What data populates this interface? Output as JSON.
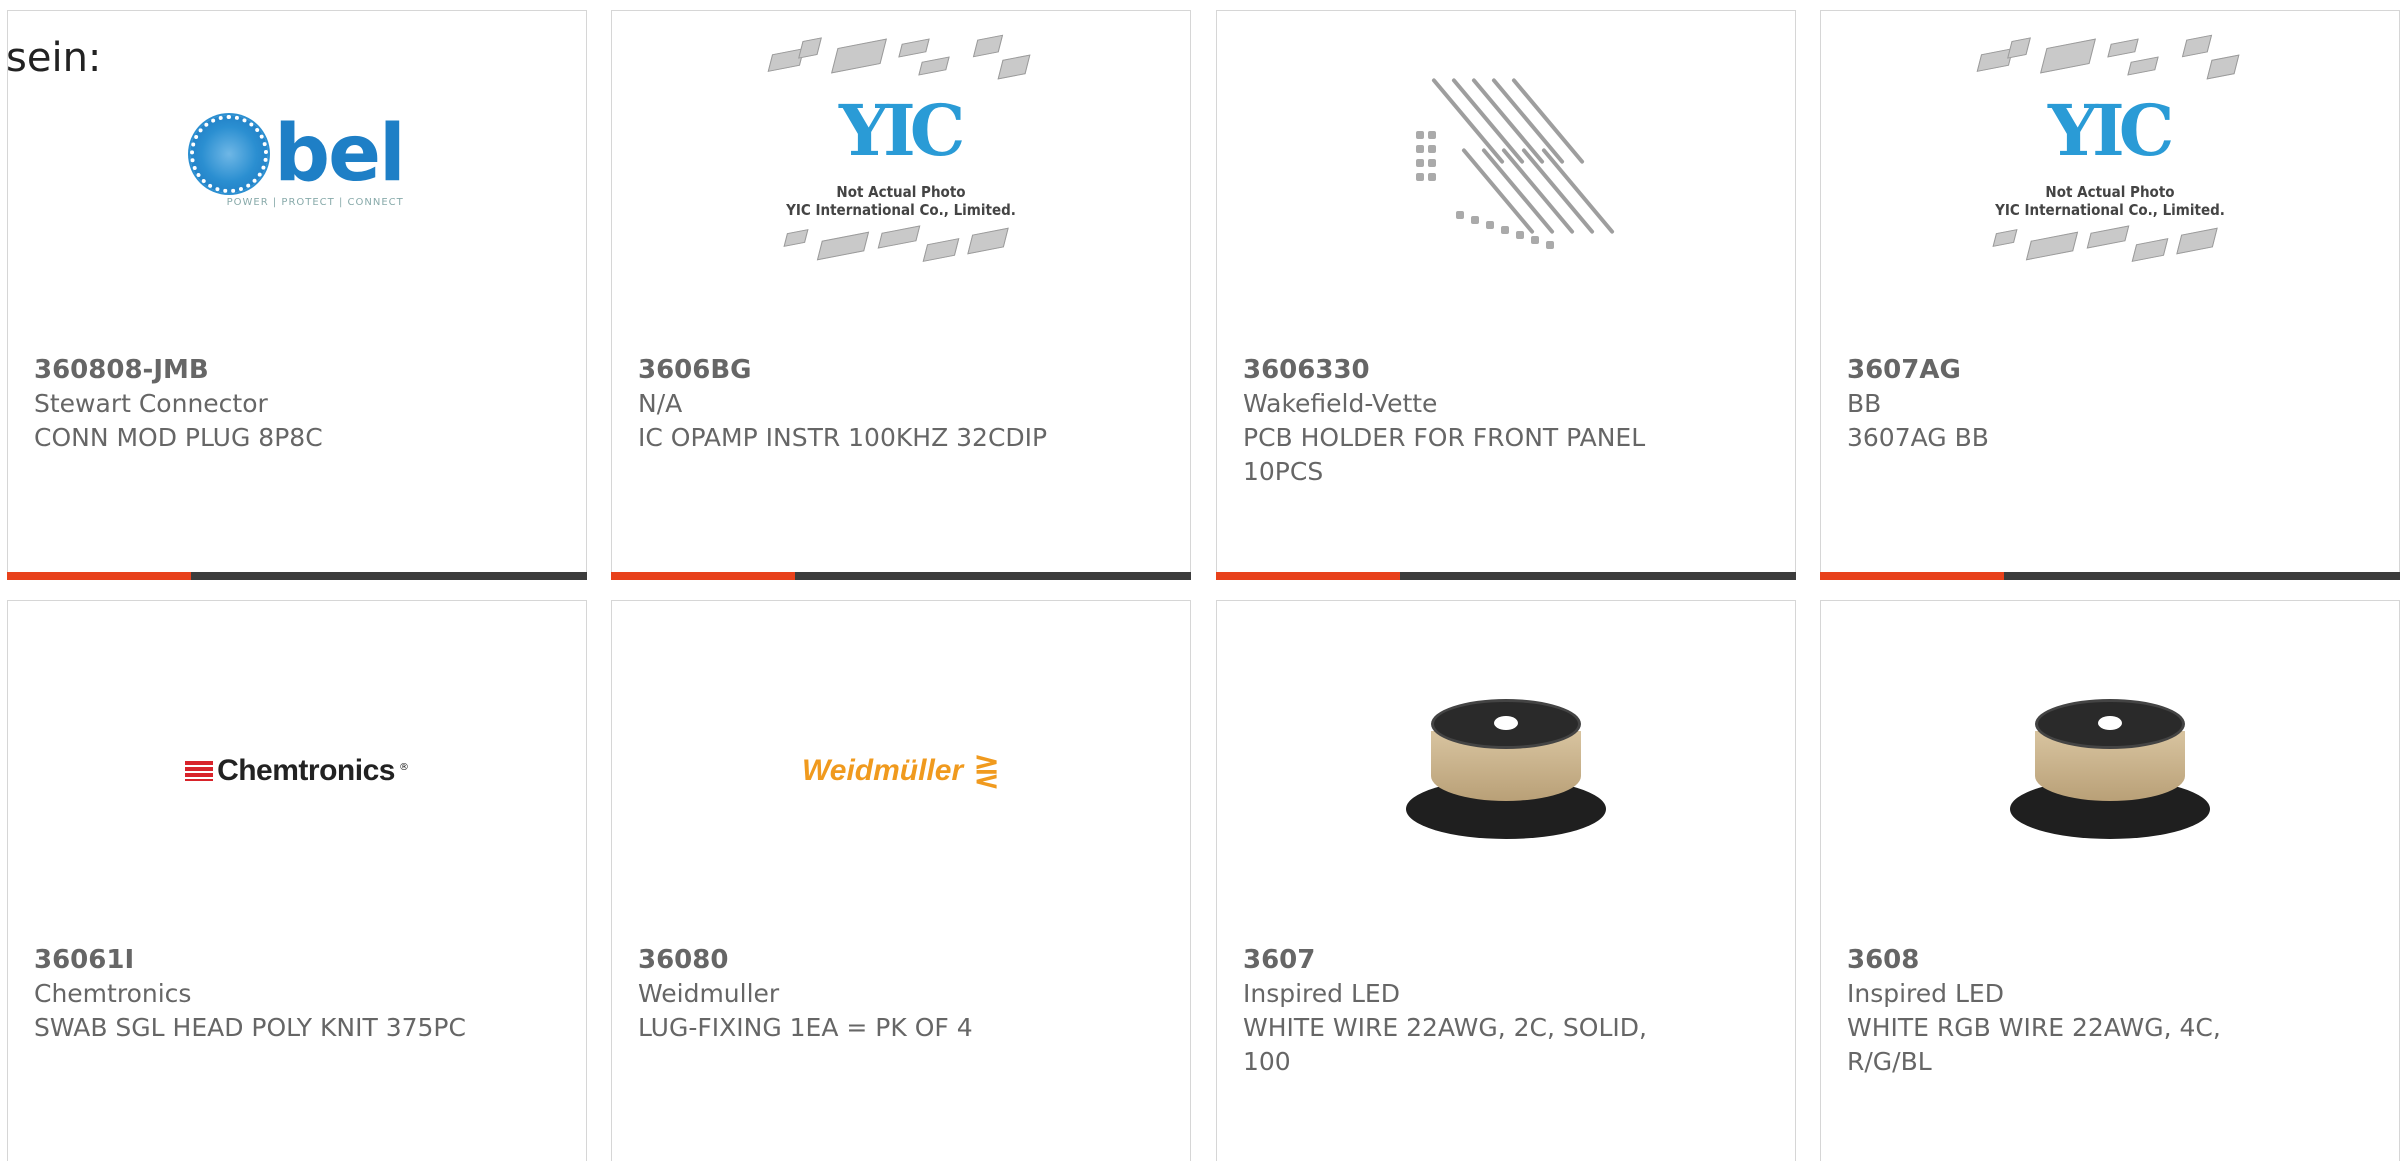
{
  "lead_text": "sein:",
  "colors": {
    "accent": "#e8411b",
    "bar": "#3c3c3c",
    "border": "#d6d6d6"
  },
  "products": [
    {
      "part_number": "360808-JMB",
      "manufacturer": "Stewart Connector",
      "description": "CONN MOD PLUG 8P8C",
      "image": "bel-logo",
      "logo_text": "bel",
      "logo_tagline": "POWER | PROTECT | CONNECT"
    },
    {
      "part_number": "3606BG",
      "manufacturer": "N/A",
      "description": "IC OPAMP INSTR 100KHZ 32CDIP",
      "image": "yic-placeholder",
      "logo_text": "YIC",
      "placeholder_line1": "Not Actual Photo",
      "placeholder_line2": "YIC International Co., Limited."
    },
    {
      "part_number": "3606330",
      "manufacturer": "Wakefield-Vette",
      "description": "PCB HOLDER FOR FRONT PANEL 10PCS",
      "image": "pcb-holders-photo"
    },
    {
      "part_number": "3607AG",
      "manufacturer": "BB",
      "description": "3607AG BB",
      "image": "yic-placeholder",
      "logo_text": "YIC",
      "placeholder_line1": "Not Actual Photo",
      "placeholder_line2": "YIC International Co., Limited."
    },
    {
      "part_number": "36061I",
      "manufacturer": "Chemtronics",
      "description": "SWAB SGL HEAD POLY KNIT 375PC",
      "image": "chemtronics-logo",
      "logo_text": "Chemtronics"
    },
    {
      "part_number": "36080",
      "manufacturer": "Weidmuller",
      "description": "LUG-FIXING 1EA = PK OF 4",
      "image": "weidmuller-logo",
      "logo_text": "Weidmüller"
    },
    {
      "part_number": "3607",
      "manufacturer": "Inspired LED",
      "description": "WHITE WIRE 22AWG, 2C, SOLID, 100",
      "image": "wire-spool-photo"
    },
    {
      "part_number": "3608",
      "manufacturer": "Inspired LED",
      "description": "WHITE RGB WIRE 22AWG, 4C, R/G/BL",
      "image": "wire-spool-photo"
    }
  ]
}
